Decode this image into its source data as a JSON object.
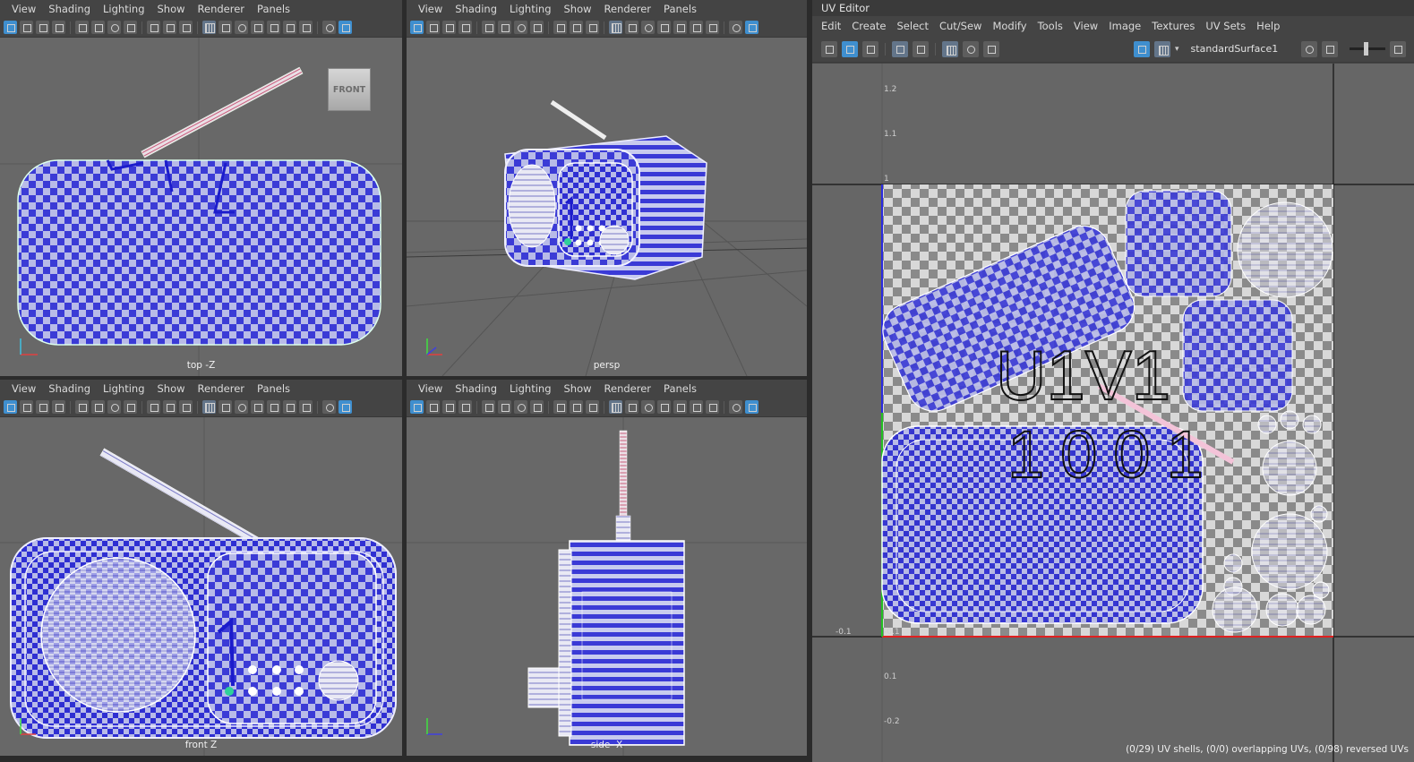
{
  "viewport_menu": [
    "View",
    "Shading",
    "Lighting",
    "Show",
    "Renderer",
    "Panels"
  ],
  "viewports": {
    "top": {
      "label": "top -Z"
    },
    "persp": {
      "label": "persp"
    },
    "front": {
      "label": "front Z"
    },
    "side": {
      "label": "side -X"
    }
  },
  "viewcube_label": "FRONT",
  "uv_editor": {
    "title": "UV Editor",
    "menu": [
      "Edit",
      "Create",
      "Select",
      "Cut/Sew",
      "Modify",
      "Tools",
      "View",
      "Image",
      "Textures",
      "UV Sets",
      "Help"
    ],
    "shader": "standardSurface1",
    "tile_label_uv": "U1V1",
    "tile_label_udim": "1001",
    "ticks": [
      "1.2",
      "1.1",
      "1",
      "-0.1",
      "0.1",
      "-0.1",
      "-0.2"
    ],
    "status": "(0/29) UV shells, (0/0) overlapping UVs, (0/98) reversed UVs"
  },
  "colors": {
    "checker_blue": "#3030d8",
    "checker_light": "#b4b8e6",
    "viewport_bg": "#686868",
    "ui_bg": "#444444",
    "accent": "#3f8fcf"
  }
}
